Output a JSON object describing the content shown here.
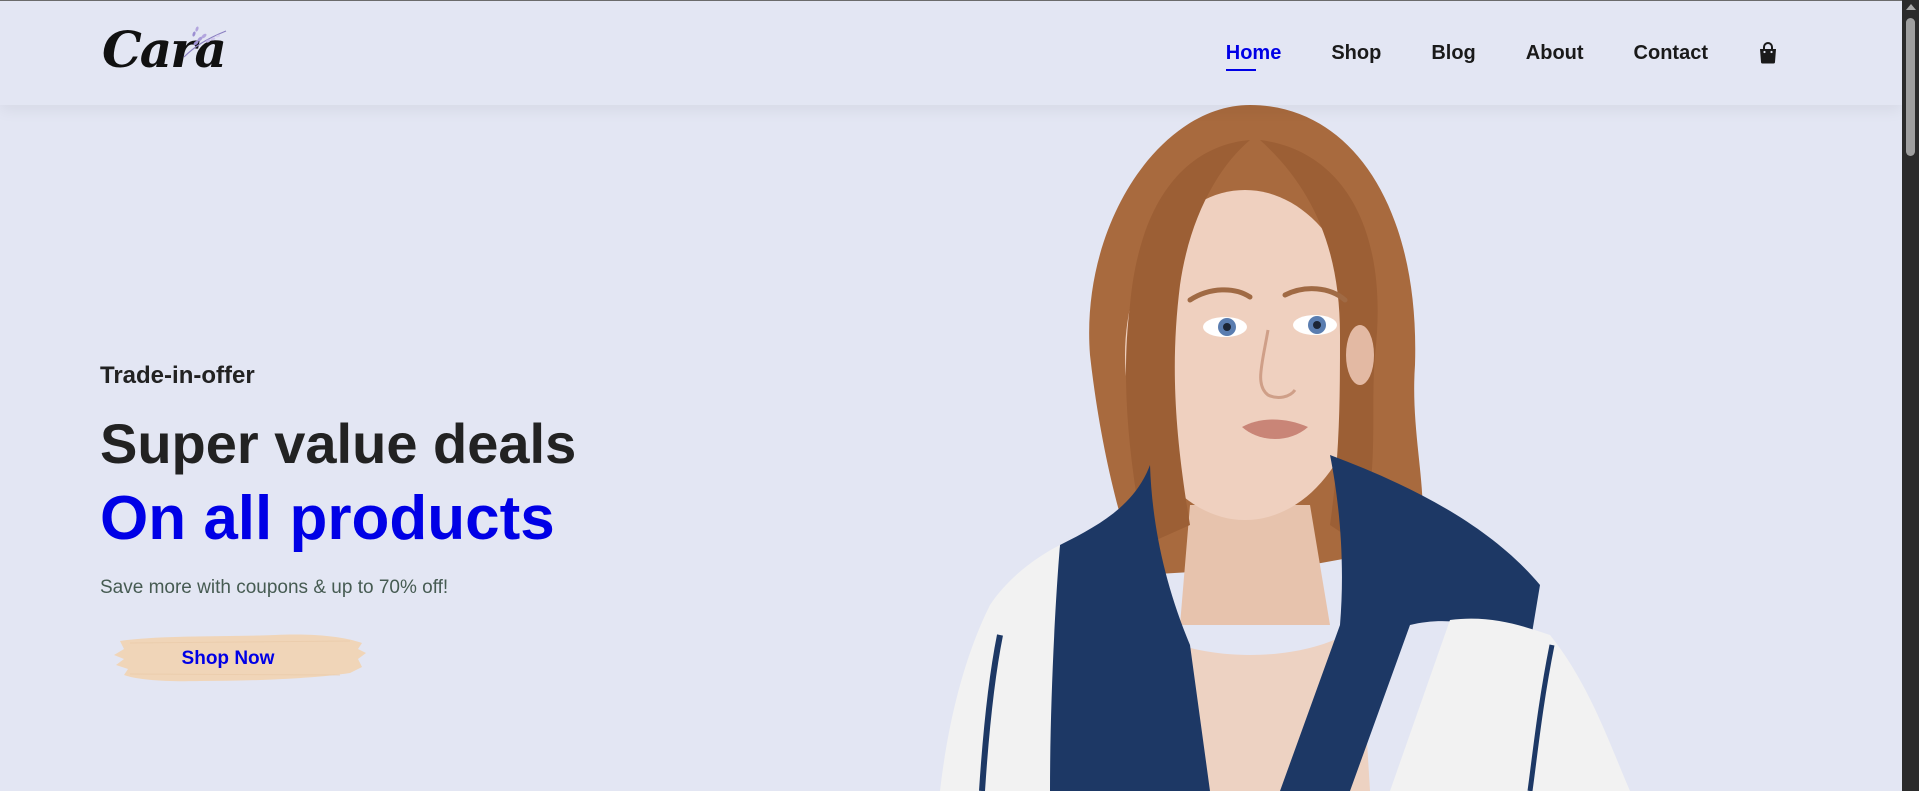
{
  "brand": {
    "name": "Cara"
  },
  "nav": {
    "items": [
      {
        "label": "Home",
        "active": true
      },
      {
        "label": "Shop",
        "active": false
      },
      {
        "label": "Blog",
        "active": false
      },
      {
        "label": "About",
        "active": false
      },
      {
        "label": "Contact",
        "active": false
      }
    ],
    "cart_icon": "shopping-bag-icon"
  },
  "hero": {
    "subtitle": "Trade-in-offer",
    "heading": "Super value deals",
    "highlight": "On all products",
    "description": "Save more with coupons & up to 70% off!",
    "button_label": "Shop Now"
  },
  "colors": {
    "background": "#e3e6f3",
    "accent": "#0000e6",
    "text_dark": "#222222",
    "text_muted": "#465b52",
    "button_brush": "#f0d5b8",
    "jacket_navy": "#1d3865"
  }
}
